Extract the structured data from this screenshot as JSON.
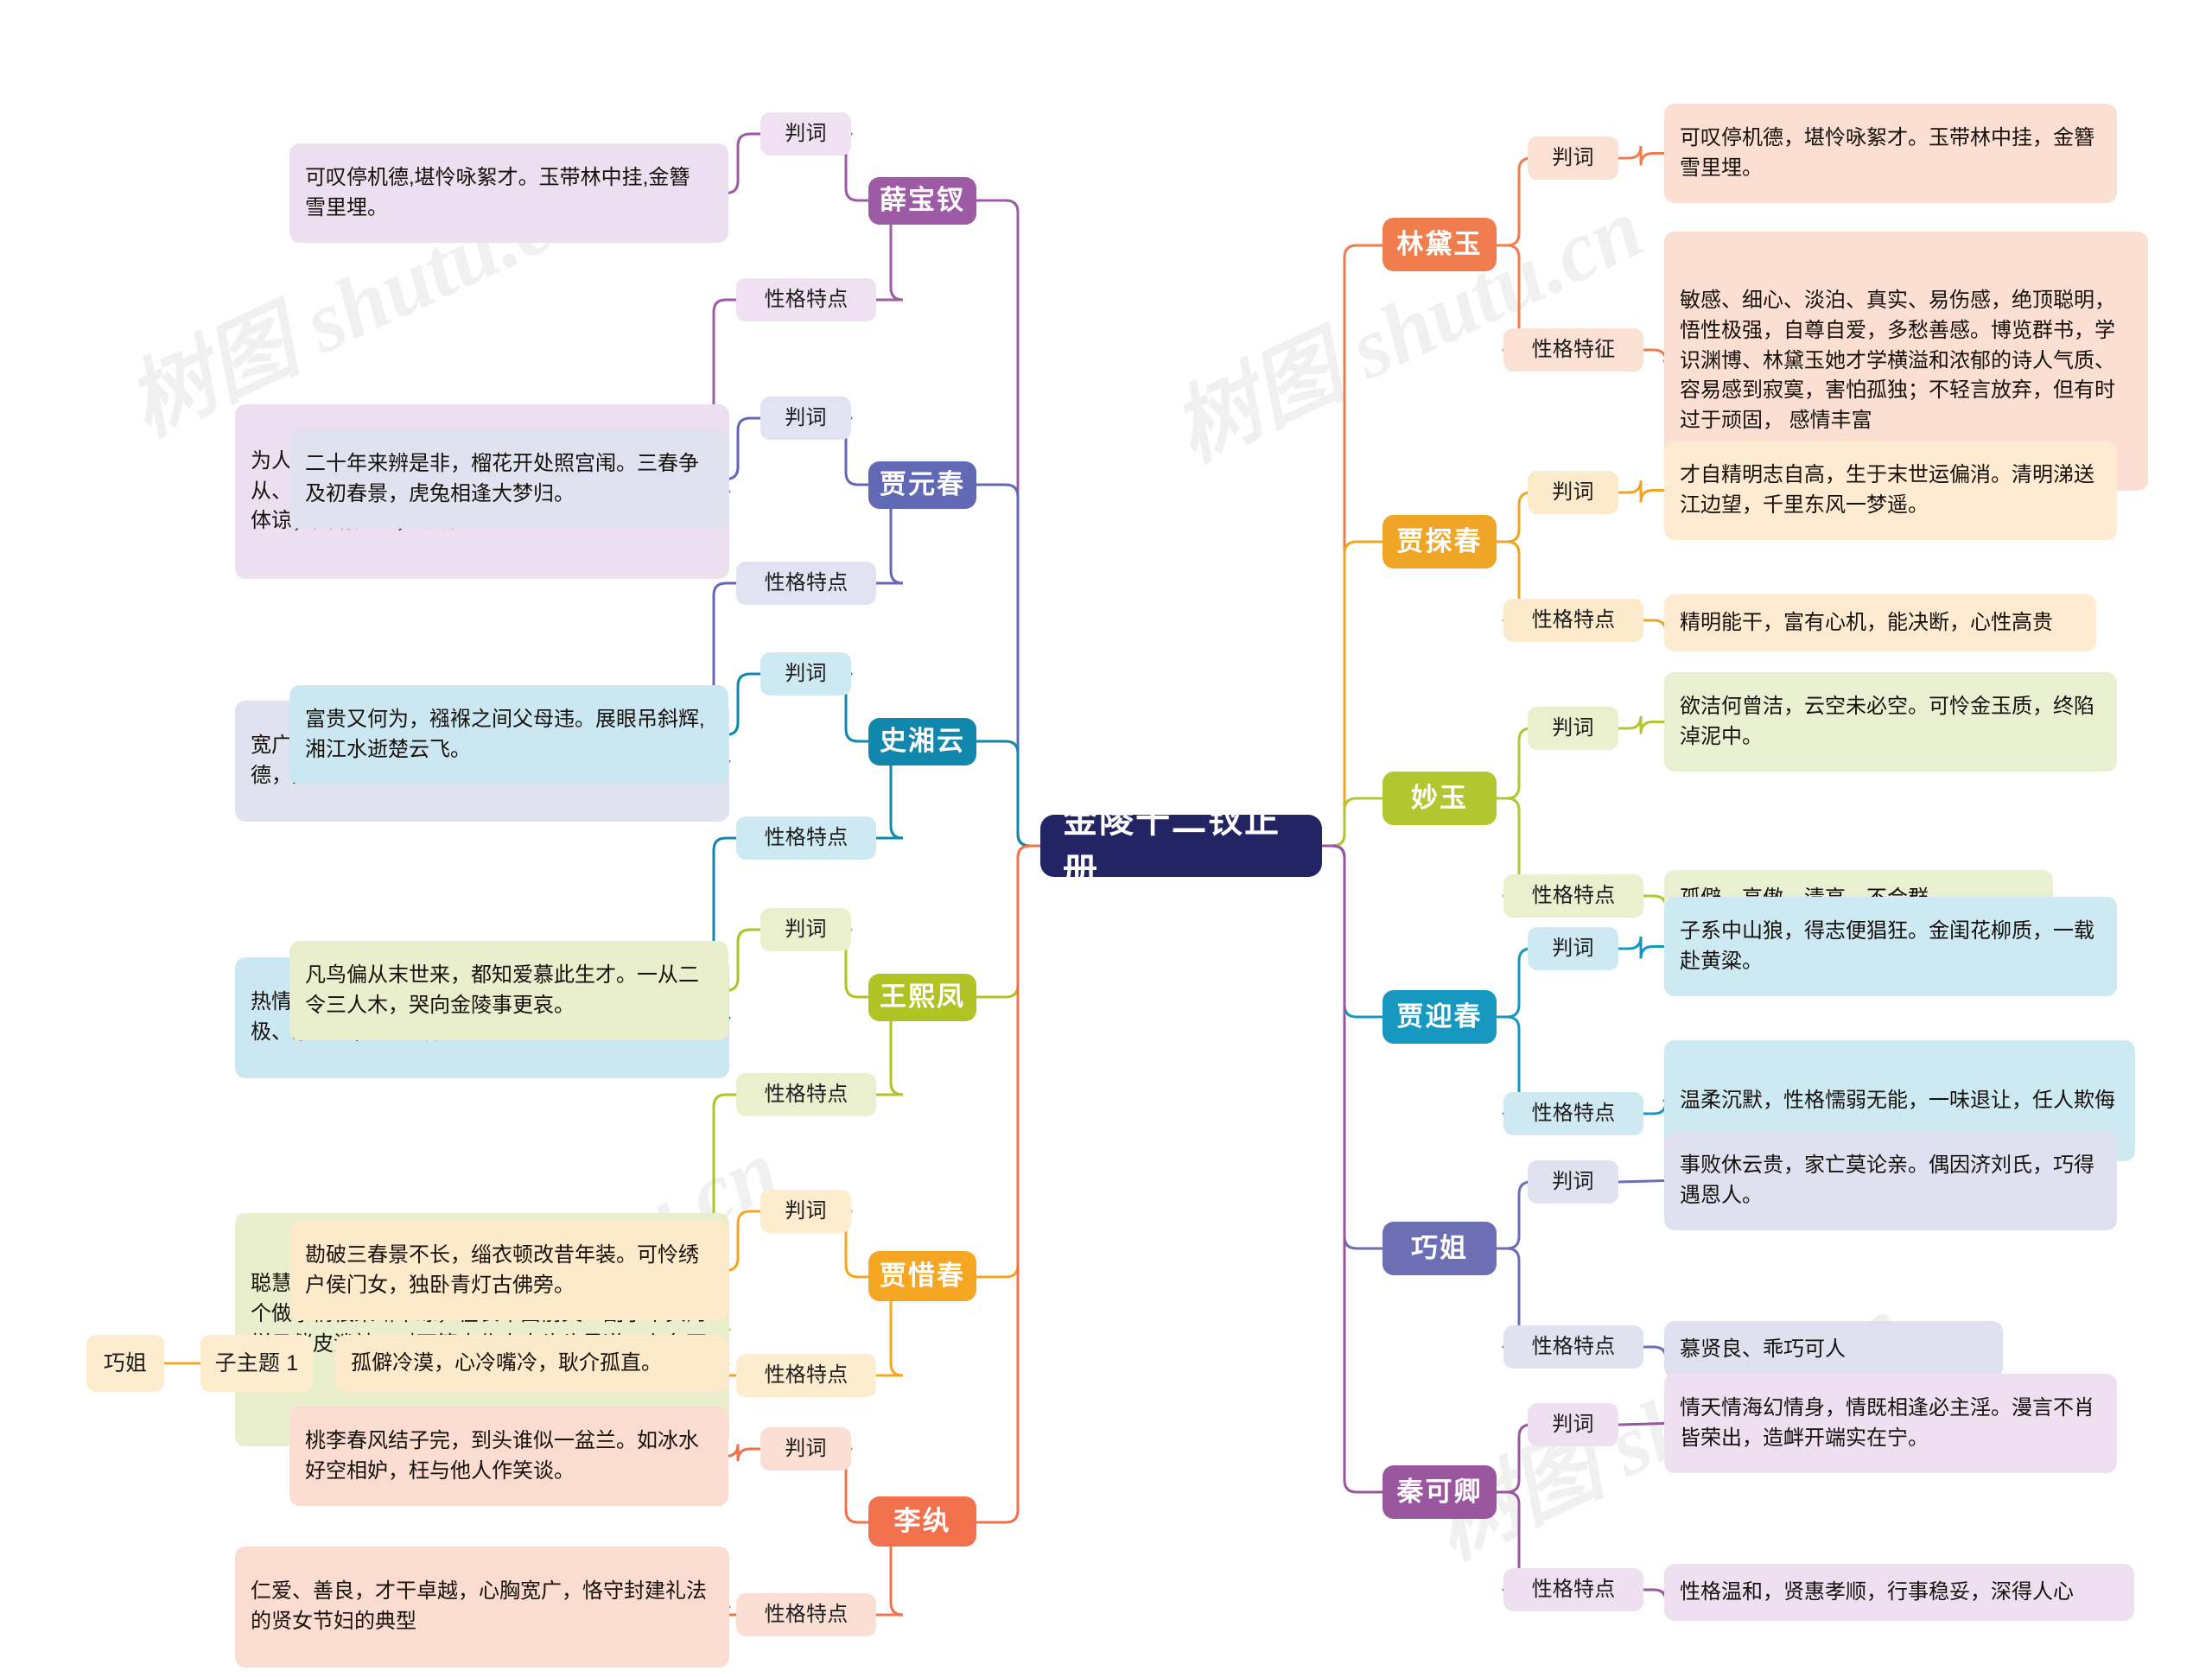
{
  "root": {
    "label": "金陵十二钗正册"
  },
  "labels": {
    "verdict": "判词",
    "traits": "性格特点",
    "traits_alt": "性格特征",
    "subtopic": "子主题 1"
  },
  "watermark": {
    "text": "树图 shutu.cn"
  },
  "colors": {
    "root_bg": "#232463",
    "xue_baochai": "#9c5ba4",
    "jia_yuanchun": "#6168b4",
    "shi_xiangyun": "#1287ad",
    "wang_xifeng": "#b0c224",
    "jia_xichun": "#f5a623",
    "li_wan": "#f0714c",
    "lin_daiyu": "#ef7d4e",
    "jia_tanchun": "#efa526",
    "miao_yu": "#b2c630",
    "jia_yingchun": "#1798c1",
    "qiao_jie": "#6d6fb5",
    "qin_keqing": "#9a569f"
  },
  "left_branches": [
    {
      "name": "薛宝钗",
      "color": "#9c5ba4",
      "chip_bg": "#efe1f2",
      "box_bg": "#ece0f0",
      "items": [
        {
          "label": "判词",
          "text": "可叹停机德,堪怜咏絮才。玉带林中挂,金簪 雪里埋。"
        },
        {
          "label": "性格特点",
          "text": "为人处事不慌乱,做事情不留情;稳重、平和、顺从、体贴;巧妙的忍耐,伸张正义。稳重平和；恭顺体谅；圆滑隐忍；深明大义"
        }
      ]
    },
    {
      "name": "贾元春",
      "color": "#6168b4",
      "chip_bg": "#e2e3f2",
      "box_bg": "#e0e2f0",
      "items": [
        {
          "label": "判词",
          "text": "二十年来辨是非，榴花开处照宫闱。三春争及初春景，虎兔相逢大梦归。"
        },
        {
          "label": "性格特点",
          "text": "宽广懂事,贵气柔和,曲折多难,柔韧温和，贤孝才德，身份高贵，养尊处优，雍容大度"
        }
      ]
    },
    {
      "name": "史湘云",
      "color": "#1287ad",
      "chip_bg": "#cdeaf3",
      "box_bg": "#cbe8f2",
      "items": [
        {
          "label": "判词",
          "text": "富贵又何为，襁褓之间父母违。展眼吊斜辉,湘江水逝楚云飞。"
        },
        {
          "label": "性格特点",
          "text": "热情豪爽和心直口快，率直、平等待人、洒脱积极、乐观的,她以诚待人"
        }
      ]
    },
    {
      "name": "王熙凤",
      "color": "#b0c224",
      "chip_bg": "#eaf0cd",
      "box_bg": "#e9efcc",
      "items": [
        {
          "label": "判词",
          "text": "凡鸟偏从末世来，都知爱慕此生才。一从二令三人木，哭向金陵事更哀。"
        },
        {
          "label": "性格特点",
          "text": "聪慧、能干、狠毒、欲望于一体。能干王熙凤是一个做事情很果断干练，在长辈面前又一副小丫头的样子俏皮泼辣，对下管束仆人来头头是道，有条不紊。"
        }
      ]
    },
    {
      "name": "贾惜春",
      "color": "#f5a623",
      "chip_bg": "#fdeccd",
      "box_bg": "#fdeacb",
      "items": [
        {
          "label": "判词",
          "text": "勘破三春景不长，缁衣顿改昔年装。可怜绣户侯门女，独卧青灯古佛旁。"
        },
        {
          "label": "性格特点",
          "text": "孤僻冷漠，心冷嘴冷，耿介孤直。"
        }
      ]
    },
    {
      "name": "李纨",
      "color": "#f0714c",
      "chip_bg": "#fbdfd4",
      "box_bg": "#fbdcd0",
      "items": [
        {
          "label": "判词",
          "text": "桃李春风结子完，到头谁似一盆兰。如冰水好空相妒，枉与他人作笑谈。"
        },
        {
          "label": "性格特点",
          "text": "仁爱、善良，才干卓越，心胸宽广，恪守封建礼法的贤女节妇的典型"
        }
      ]
    }
  ],
  "extra_left": {
    "qiao_jie_label": "巧姐",
    "subtopic_label": "子主题 1",
    "chip_bg": "#fdeccd",
    "color": "#f5a623"
  },
  "right_branches": [
    {
      "name": "林黛玉",
      "color": "#ef7d4e",
      "chip_bg": "#fbe0d4",
      "box_bg": "#fadfd2",
      "items": [
        {
          "label": "判词",
          "text": "可叹停机德，堪怜咏絮才。玉带林中挂，金簪雪里埋。"
        },
        {
          "label": "性格特征",
          "text": "敏感、细心、淡泊、真实、易伤感，绝顶聪明，悟性极强，自尊自爱，多愁善感。博览群书，学识渊博、林黛玉她才学横溢和浓郁的诗人气质、容易感到寂寞，害怕孤独；不轻言放弃，但有时过于顽固， 感情丰富"
        }
      ]
    },
    {
      "name": "贾探春",
      "color": "#efa526",
      "chip_bg": "#fdeacb",
      "box_bg": "#fdead0",
      "items": [
        {
          "label": "判词",
          "text": "才自精明志自高，生于末世运偏消。清明涕送江边望，千里东风一梦遥。"
        },
        {
          "label": "性格特点",
          "text": "精明能干，富有心机，能决断，心性高贵"
        }
      ]
    },
    {
      "name": "妙玉",
      "color": "#b2c630",
      "chip_bg": "#eaefce",
      "box_bg": "#e9f0d2",
      "items": [
        {
          "label": "判词",
          "text": "欲洁何曾洁，云空未必空。可怜金玉质，终陷淖泥中。"
        },
        {
          "label": "性格特点",
          "text": "孤僻、高傲、清高、不合群"
        }
      ]
    },
    {
      "name": "贾迎春",
      "color": "#1798c1",
      "chip_bg": "#cfe9f2",
      "box_bg": "#cde9f2",
      "items": [
        {
          "label": "判词",
          "text": "子系中山狼，得志便猖狂。金闺花柳质，一载赴黄粱。"
        },
        {
          "label": "性格特点",
          "text": "温柔沉默，性格懦弱无能，一味退让，任人欺侮"
        }
      ]
    },
    {
      "name": "巧姐",
      "color": "#6d6fb5",
      "chip_bg": "#e1e2f0",
      "box_bg": "#e0e1f0",
      "items": [
        {
          "label": "判词",
          "text": "事败休云贵，家亡莫论亲。偶因济刘氏，巧得遇恩人。"
        },
        {
          "label": "性格特点",
          "text": "慕贤良、乖巧可人"
        }
      ]
    },
    {
      "name": "秦可卿",
      "color": "#9a569f",
      "chip_bg": "#eee0f0",
      "box_bg": "#eee0f0",
      "items": [
        {
          "label": "判词",
          "text": "情天情海幻情身，情既相逢必主淫。漫言不肖皆荣出，造衅开端实在宁。"
        },
        {
          "label": "性格特点",
          "text": "性格温和，贤惠孝顺，行事稳妥，深得人心"
        }
      ]
    }
  ]
}
